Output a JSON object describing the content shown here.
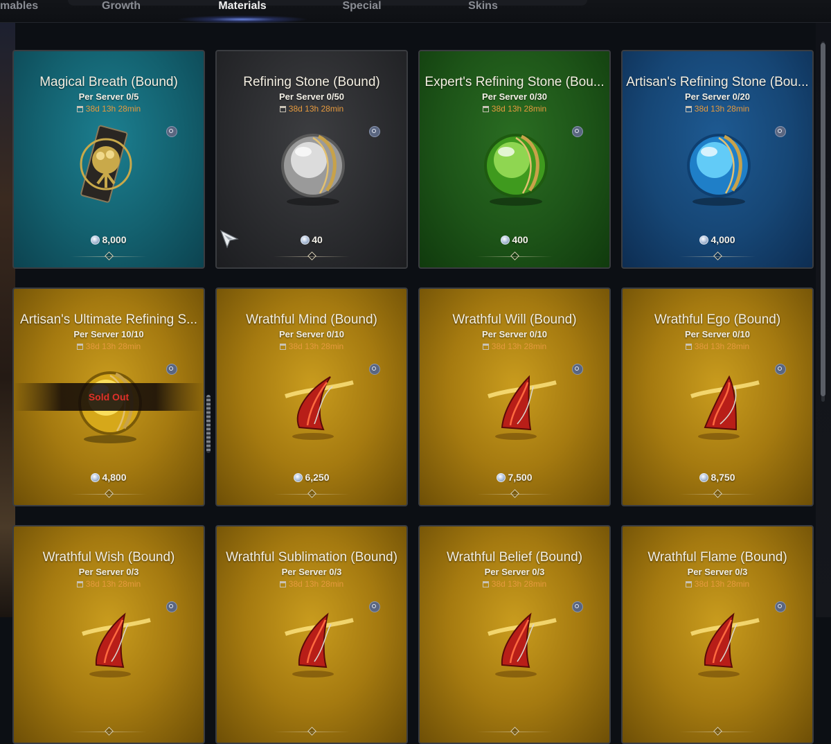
{
  "tabs": [
    {
      "label": "mables",
      "active": false
    },
    {
      "label": "Growth",
      "active": false
    },
    {
      "label": "Materials",
      "active": true
    },
    {
      "label": "Special",
      "active": false
    },
    {
      "label": "Skins",
      "active": false
    }
  ],
  "items": [
    {
      "name": "Magical Breath (Bound)",
      "limit": "Per Server  0/5",
      "timer": "38d 13h 28min",
      "price": "8,000",
      "theme": "teal",
      "icon": "magical-breath-icon",
      "sold_out": false
    },
    {
      "name": "Refining Stone (Bound)",
      "limit": "Per Server  0/50",
      "timer": "38d 13h 28min",
      "price": "40",
      "theme": "dark",
      "icon": "refining-stone-icon",
      "sold_out": false
    },
    {
      "name": "Expert's Refining Stone (Bou...",
      "limit": "Per Server  0/30",
      "timer": "38d 13h 28min",
      "price": "400",
      "theme": "green",
      "icon": "expert-refining-stone-icon",
      "sold_out": false
    },
    {
      "name": "Artisan's Refining Stone (Bou...",
      "limit": "Per Server  0/20",
      "timer": "38d 13h 28min",
      "price": "4,000",
      "theme": "blue",
      "icon": "artisan-refining-stone-icon",
      "sold_out": false
    },
    {
      "name": "Artisan's Ultimate Refining S...",
      "limit": "Per Server  10/10",
      "timer": "38d 13h 28min",
      "price": "4,800",
      "theme": "gold",
      "icon": "artisan-ultimate-refining-stone-icon",
      "sold_out": true
    },
    {
      "name": "Wrathful Mind (Bound)",
      "limit": "Per Server  0/10",
      "timer": "38d 13h 28min",
      "price": "6,250",
      "theme": "gold",
      "icon": "wrathful-mind-icon",
      "sold_out": false
    },
    {
      "name": "Wrathful Will (Bound)",
      "limit": "Per Server  0/10",
      "timer": "38d 13h 28min",
      "price": "7,500",
      "theme": "gold",
      "icon": "wrathful-will-icon",
      "sold_out": false
    },
    {
      "name": "Wrathful Ego (Bound)",
      "limit": "Per Server  0/10",
      "timer": "38d 13h 28min",
      "price": "8,750",
      "theme": "gold",
      "icon": "wrathful-ego-icon",
      "sold_out": false
    },
    {
      "name": "Wrathful Wish (Bound)",
      "limit": "Per Server  0/3",
      "timer": "38d 13h 28min",
      "price": "",
      "theme": "gold",
      "icon": "wrathful-wish-icon",
      "sold_out": false
    },
    {
      "name": "Wrathful Sublimation (Bound)",
      "limit": "Per Server  0/3",
      "timer": "38d 13h 28min",
      "price": "",
      "theme": "gold",
      "icon": "wrathful-sublimation-icon",
      "sold_out": false
    },
    {
      "name": "Wrathful Belief (Bound)",
      "limit": "Per Server  0/3",
      "timer": "38d 13h 28min",
      "price": "",
      "theme": "gold",
      "icon": "wrathful-belief-icon",
      "sold_out": false
    },
    {
      "name": "Wrathful Flame (Bound)",
      "limit": "Per Server  0/3",
      "timer": "38d 13h 28min",
      "price": "",
      "theme": "gold",
      "icon": "wrathful-flame-icon",
      "sold_out": false
    }
  ],
  "sold_out_label": "Sold Out",
  "colors": {
    "timer": "#e59a3e",
    "sold_out": "#e0302a",
    "tab_active": "#f2f2f2",
    "tab_inactive": "#8a8d94"
  }
}
